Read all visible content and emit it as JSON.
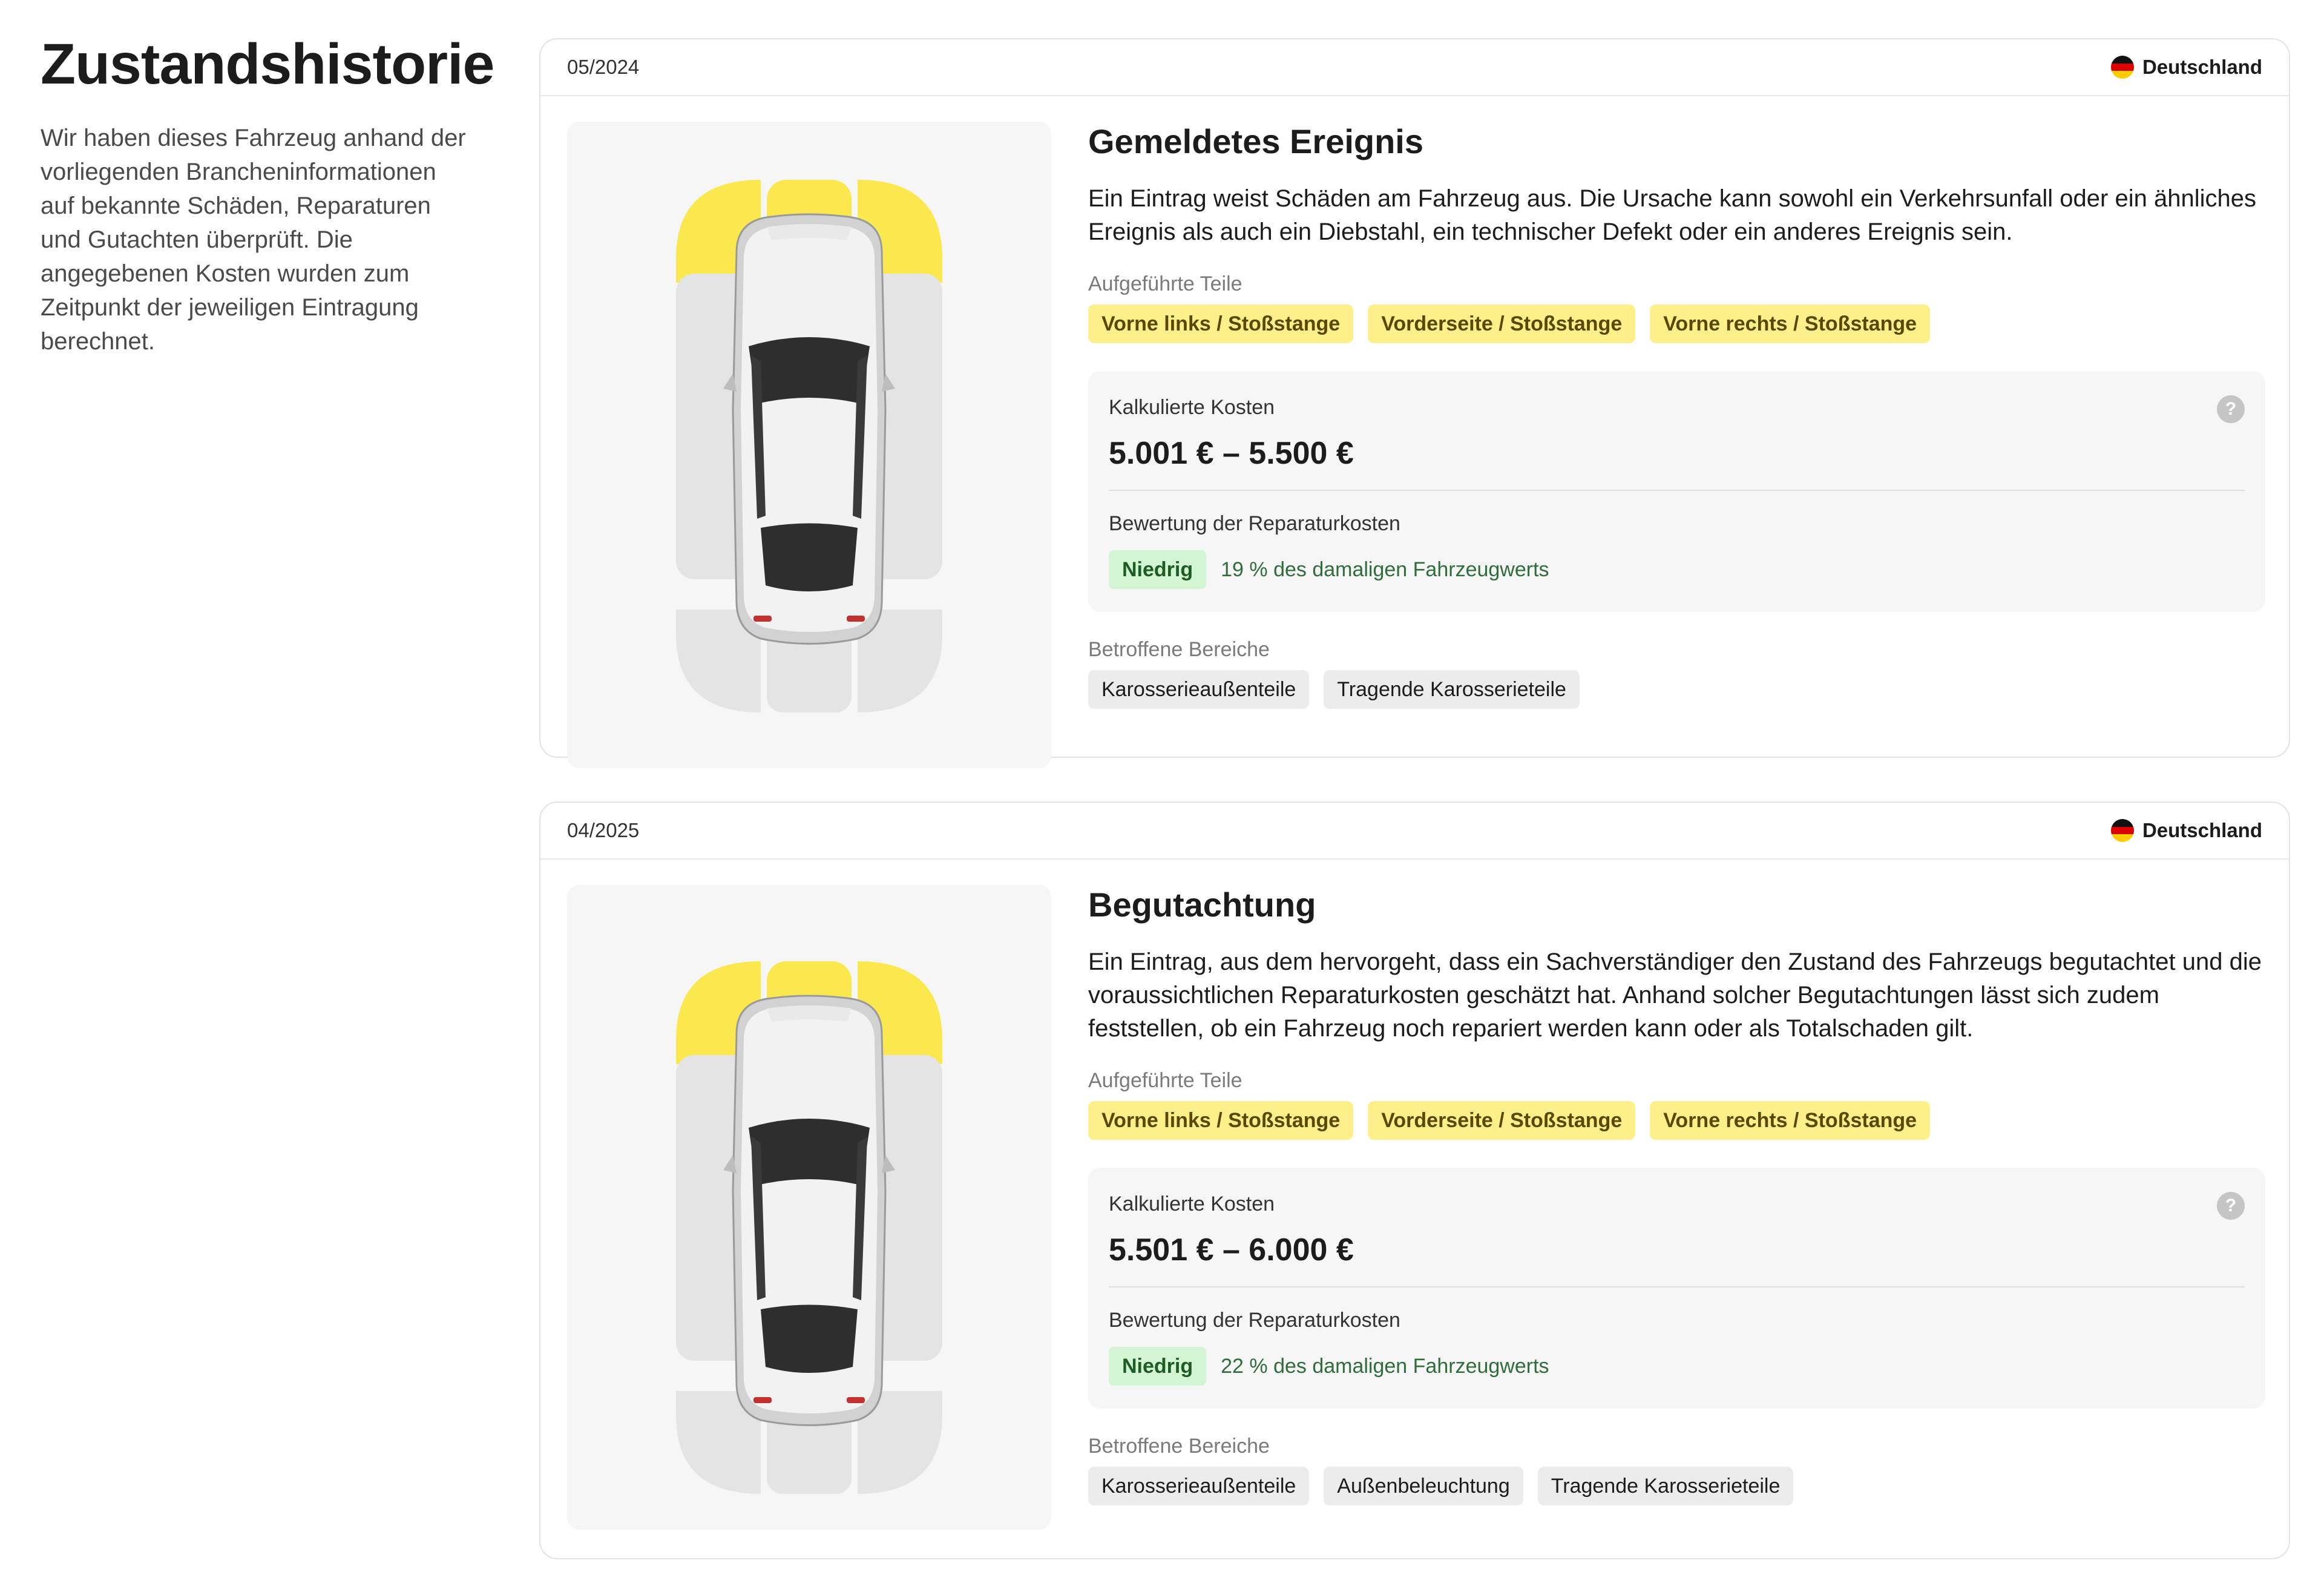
{
  "sidebar": {
    "title": "Zustandshistorie",
    "description": "Wir haben dieses Fahrzeug anhand der vorliegenden Brancheninformationen auf bekannte Schäden, Reparaturen und Gutachten überprüft. Die angegebenen Kosten wurden zum Zeitpunkt der jeweiligen Eintragung berechnet."
  },
  "colors": {
    "damage_highlight": "#fbe84f",
    "zone_neutral": "#e4e4e4",
    "badge_green": "#d4f5d4"
  },
  "events": [
    {
      "date": "05/2024",
      "country": "Deutschland",
      "title": "Gemeldetes Ereignis",
      "description": "Ein Eintrag weist Schäden am Fahrzeug aus. Die Ursache kann sowohl ein Verkehrsunfall oder ein ähnliches Ereignis als auch ein Diebstahl, ein technischer Defekt oder ein anderes Ereignis sein.",
      "parts_label": "Aufgeführte Teile",
      "parts": [
        "Vorne links / Stoßstange",
        "Vorderseite / Stoßstange",
        "Vorne rechts / Stoßstange"
      ],
      "cost_label": "Kalkulierte Kosten",
      "cost_value": "5.001 € – 5.500 €",
      "help_icon": "question-icon",
      "evaluation_label": "Bewertung der Reparaturkosten",
      "evaluation_badge": "Niedrig",
      "evaluation_text": "19 % des damaligen Fahrzeugwerts",
      "areas_label": "Betroffene Bereiche",
      "areas": [
        "Karosserieaußenteile",
        "Tragende Karosserieteile"
      ]
    },
    {
      "date": "04/2025",
      "country": "Deutschland",
      "title": "Begutachtung",
      "description": "Ein Eintrag, aus dem hervorgeht, dass ein Sachverständiger den Zustand des Fahrzeugs begutachtet und die voraussichtlichen Reparaturkosten geschätzt hat. Anhand solcher Begutachtungen lässt sich zudem feststellen, ob ein Fahrzeug noch repariert werden kann oder als Totalschaden gilt.",
      "parts_label": "Aufgeführte Teile",
      "parts": [
        "Vorne links / Stoßstange",
        "Vorderseite / Stoßstange",
        "Vorne rechts / Stoßstange"
      ],
      "cost_label": "Kalkulierte Kosten",
      "cost_value": "5.501 € – 6.000 €",
      "help_icon": "question-icon",
      "evaluation_label": "Bewertung der Reparaturkosten",
      "evaluation_badge": "Niedrig",
      "evaluation_text": "22 % des damaligen Fahrzeugwerts",
      "areas_label": "Betroffene Bereiche",
      "areas": [
        "Karosserieaußenteile",
        "Außenbeleuchtung",
        "Tragende Karosserieteile"
      ]
    }
  ]
}
